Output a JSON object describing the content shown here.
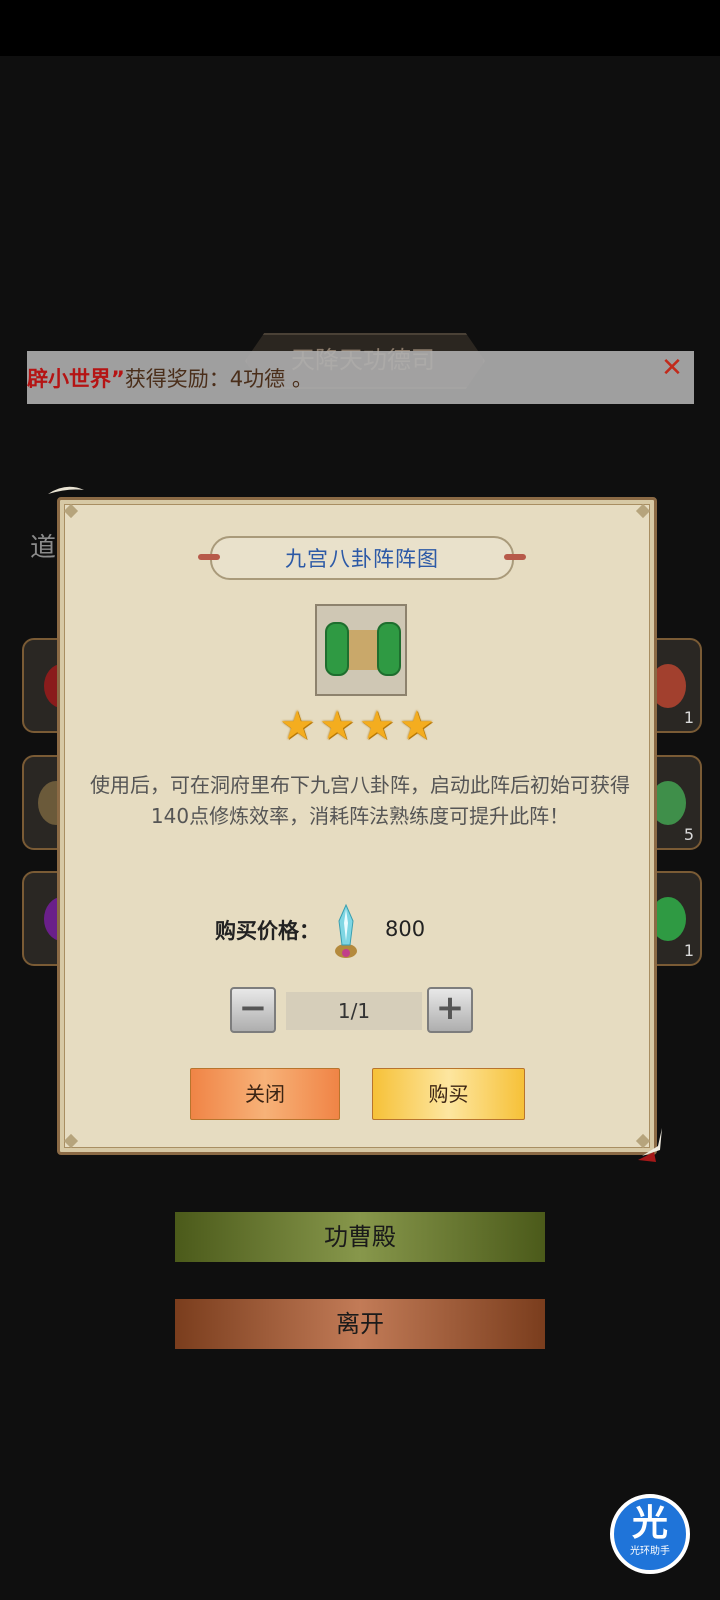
{
  "header": {
    "title": "天降天功德司"
  },
  "notice": {
    "highlight": "辟小世界”",
    "text": "获得奖励：4功德 。",
    "close_icon": "close-icon"
  },
  "side": {
    "label": "道",
    "slot_counts": [
      "1",
      "5",
      "1"
    ]
  },
  "dialog": {
    "title": "九宫八卦阵阵图",
    "item_icon": "scroll-icon",
    "stars": 4,
    "description": "使用后，可在洞府里布下九宫八卦阵，启动此阵后初始可获得140点修炼效率，消耗阵法熟练度可提升此阵！",
    "price_label": "购买价格：",
    "price_value": "800",
    "currency_icon": "jade-gem-icon",
    "quantity": "1/1",
    "minus_label": "−",
    "plus_label": "+",
    "close_label": "关闭",
    "buy_label": "购买"
  },
  "buttons": {
    "gongcao": "功曹殿",
    "leave": "离开"
  },
  "assistant": {
    "char": "光",
    "text": "光环助手"
  },
  "colors": {
    "title_blue": "#2c59a6",
    "star": "#f4ad1f",
    "notice_red": "#b51414"
  }
}
